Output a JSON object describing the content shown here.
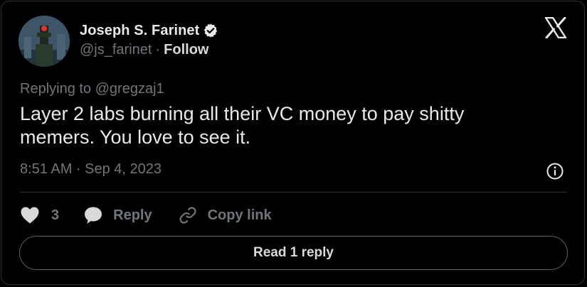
{
  "author": {
    "display_name": "Joseph S. Farinet",
    "handle": "@js_farinet",
    "separator": "·",
    "follow_label": "Follow",
    "verified": true
  },
  "tweet": {
    "replying_to": "Replying to @gregzaj1",
    "text_line1": "Layer 2 labs burning all their VC money to pay shitty",
    "text_line2": "memers. You love to see it.",
    "timestamp": "8:51 AM · Sep 4, 2023"
  },
  "actions": {
    "like_count": "3",
    "reply_label": "Reply",
    "copy_link_label": "Copy link"
  },
  "read_replies_label": "Read 1 reply",
  "icons": {
    "logo": "x-logo-icon",
    "verified": "verified-badge-icon",
    "info": "info-icon",
    "like": "heart-icon",
    "reply": "speech-bubble-icon",
    "copy": "link-icon"
  },
  "colors": {
    "background": "#000000",
    "primary_text": "#e7e9ea",
    "secondary_text": "#71767b",
    "border": "#2f3336"
  }
}
